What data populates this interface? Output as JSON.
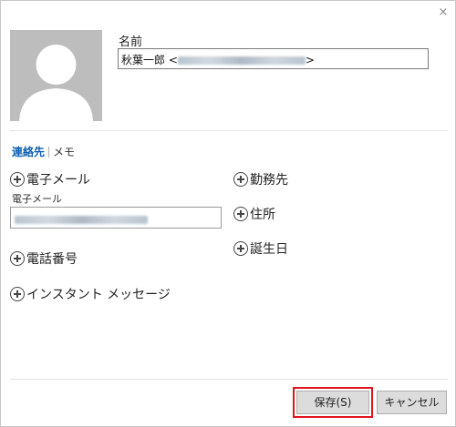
{
  "dialog": {
    "close_symbol": "×",
    "name_label": "名前",
    "name_value": "秋葉一郎 <",
    "name_value_end": ">",
    "tabs": [
      {
        "label": "連絡先",
        "active": true
      },
      {
        "label": "メモ",
        "active": false
      }
    ],
    "left_fields": [
      {
        "label": "電子メール"
      },
      {
        "label": "電話番号"
      },
      {
        "label": "インスタント メッセージ"
      }
    ],
    "email_label": "電子メール",
    "right_fields": [
      {
        "label": "勤務先"
      },
      {
        "label": "住所"
      },
      {
        "label": "誕生日"
      }
    ],
    "buttons": {
      "save": "保存(S)",
      "cancel": "キャンセル"
    }
  },
  "colors": {
    "accent": "#0b5fb3",
    "highlight_border": "#e0141e",
    "avatar_bg": "#bdbdbd"
  },
  "icons": {
    "close": "close-icon",
    "avatar": "person-silhouette-icon",
    "add": "plus-circle-icon"
  }
}
